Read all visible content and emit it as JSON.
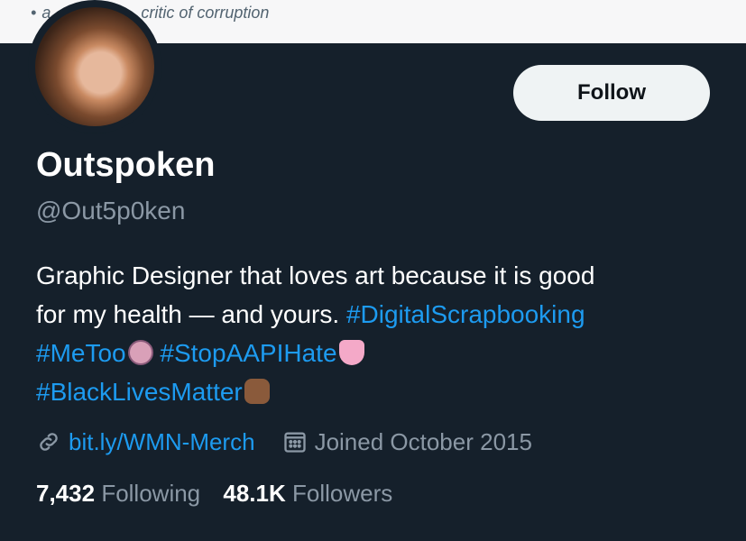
{
  "banner": {
    "text": "a",
    "text_suffix": "critic of corruption"
  },
  "profile": {
    "name": "Outspoken",
    "handle": "@Out5p0ken",
    "follow_label": "Follow",
    "bio": {
      "line1": "Graphic Designer that loves art because it is good",
      "line2_text": "for my health — and yours.",
      "hashtag1": "#DigitalScrapbooking",
      "hashtag2": "#MeToo",
      "hashtag3": "#StopAAPIHate",
      "hashtag4": "#BlackLivesMatter"
    },
    "link": "bit.ly/WMN-Merch",
    "joined": "Joined October 2015",
    "following_count": "7,432",
    "following_label": "Following",
    "followers_count": "48.1K",
    "followers_label": "Followers"
  },
  "colors": {
    "background": "#15202b",
    "link": "#1d9bf0",
    "secondary_text": "#8b98a5",
    "button_bg": "#eff3f4"
  },
  "icons": [
    "link-icon",
    "calendar-icon"
  ]
}
